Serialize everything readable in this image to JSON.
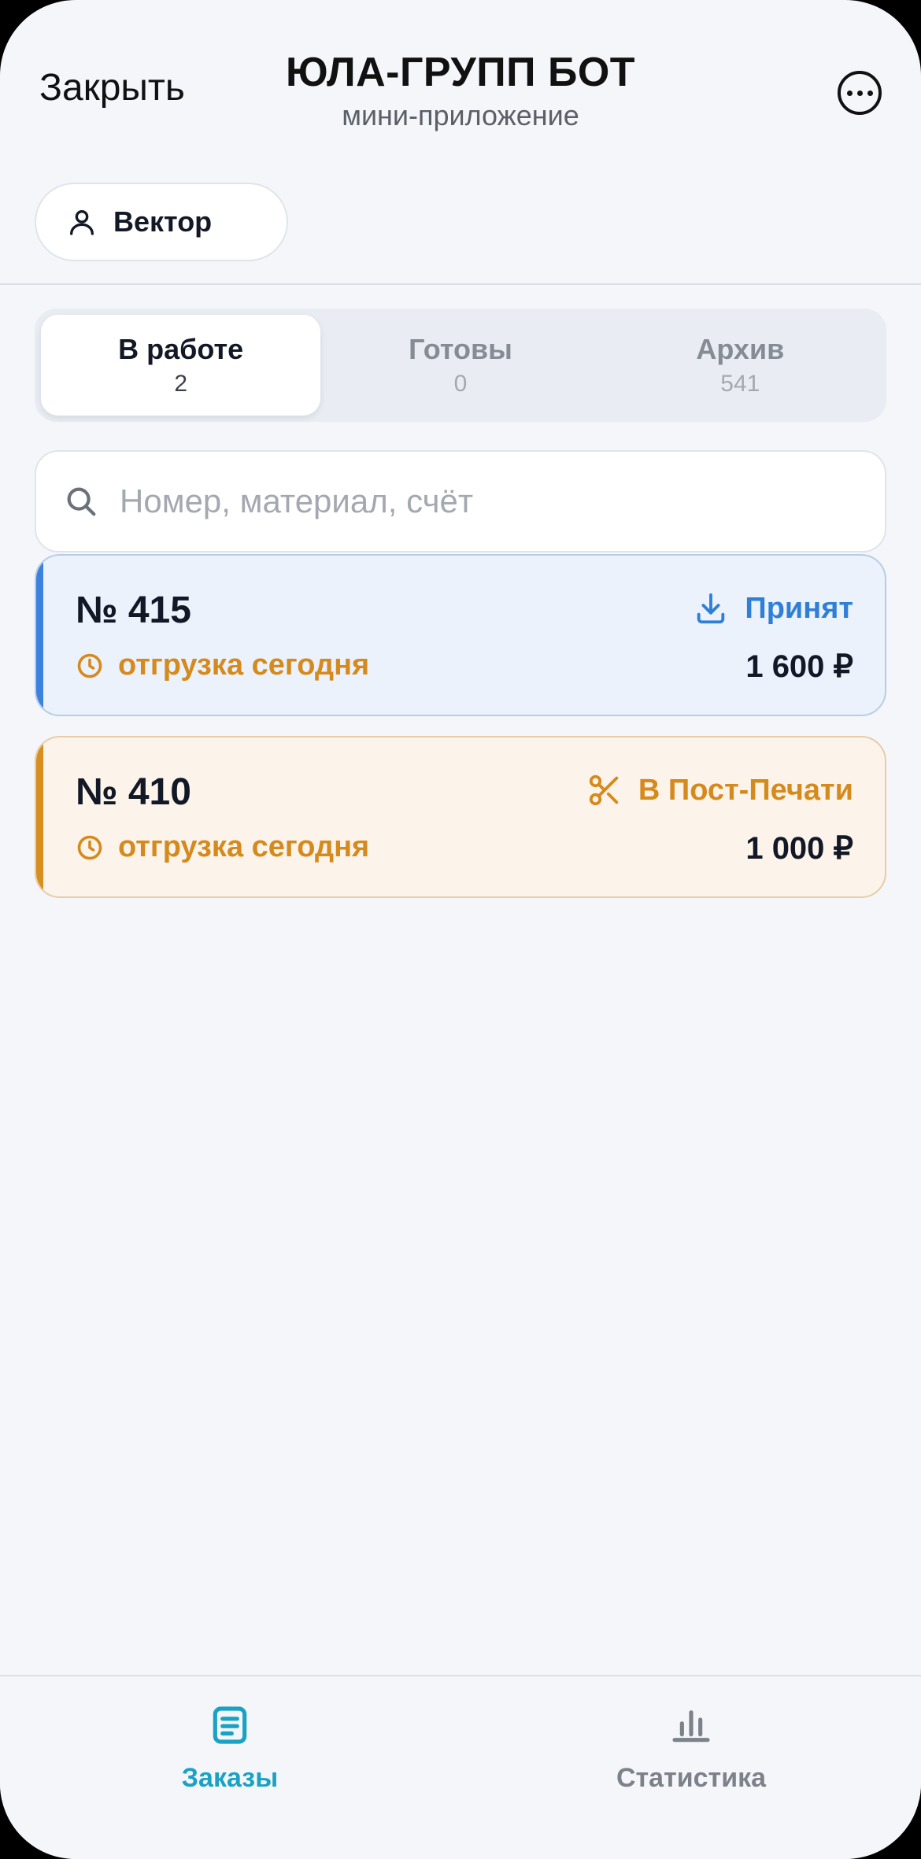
{
  "header": {
    "close_label": "Закрыть",
    "title": "ЮЛА-ГРУПП БОТ",
    "subtitle": "мини-приложение",
    "more_icon": "more-icon"
  },
  "user_chip": {
    "icon": "person-icon",
    "label": "Вектор"
  },
  "tabs": [
    {
      "label": "В работе",
      "count": "2",
      "active": true
    },
    {
      "label": "Готовы",
      "count": "0",
      "active": false
    },
    {
      "label": "Архив",
      "count": "541",
      "active": false
    }
  ],
  "search": {
    "placeholder": "Номер, материал, счёт",
    "value": "",
    "icon": "search-icon"
  },
  "orders": [
    {
      "number": "№ 415",
      "status": "Принят",
      "status_icon": "download-icon",
      "status_color": "#2f7fd6",
      "shipping": "отгрузка сегодня",
      "shipping_icon": "clock-icon",
      "price": "1 600 ₽",
      "accent_color": "#3b82e0"
    },
    {
      "number": "№ 410",
      "status": "В Пост-Печати",
      "status_icon": "scissors-icon",
      "status_color": "#d58a1d",
      "shipping": "отгрузка сегодня",
      "shipping_icon": "clock-icon",
      "price": "1 000 ₽",
      "accent_color": "#d98f1f"
    }
  ],
  "bottom_nav": [
    {
      "label": "Заказы",
      "icon": "orders-icon",
      "active": true,
      "color": "#1aa2c4"
    },
    {
      "label": "Статистика",
      "icon": "stats-icon",
      "active": false,
      "color": "#7c818a"
    }
  ]
}
